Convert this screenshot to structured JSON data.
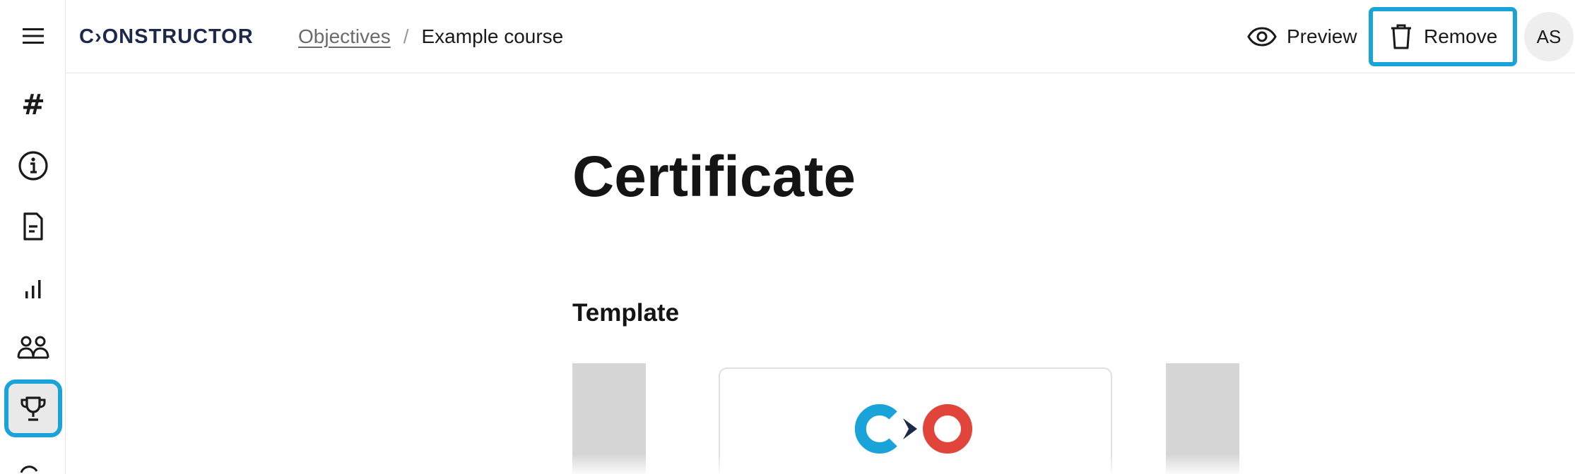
{
  "app": {
    "logo_text": "C›ONSTRUCTOR"
  },
  "breadcrumb": {
    "parent": "Objectives",
    "separator": "/",
    "current": "Example course"
  },
  "header": {
    "preview_label": "Preview",
    "remove_label": "Remove",
    "avatar_initials": "AS"
  },
  "sidebar": {
    "items": [
      {
        "name": "menu",
        "icon": "hamburger-icon"
      },
      {
        "name": "hashtags",
        "icon": "hash-icon",
        "glyph": "#"
      },
      {
        "name": "info",
        "icon": "info-icon"
      },
      {
        "name": "document",
        "icon": "document-icon"
      },
      {
        "name": "analytics",
        "icon": "bar-chart-icon"
      },
      {
        "name": "participants",
        "icon": "people-icon"
      },
      {
        "name": "certificate",
        "icon": "trophy-icon",
        "active": true
      },
      {
        "name": "more",
        "icon": "loading-icon"
      }
    ]
  },
  "main": {
    "title": "Certificate",
    "section_title": "Template"
  },
  "colors": {
    "accent_highlight": "#1aa3d9",
    "logo_navy": "#1c2a4a",
    "brand_blue": "#1aa3d9",
    "brand_red": "#e0443a"
  }
}
